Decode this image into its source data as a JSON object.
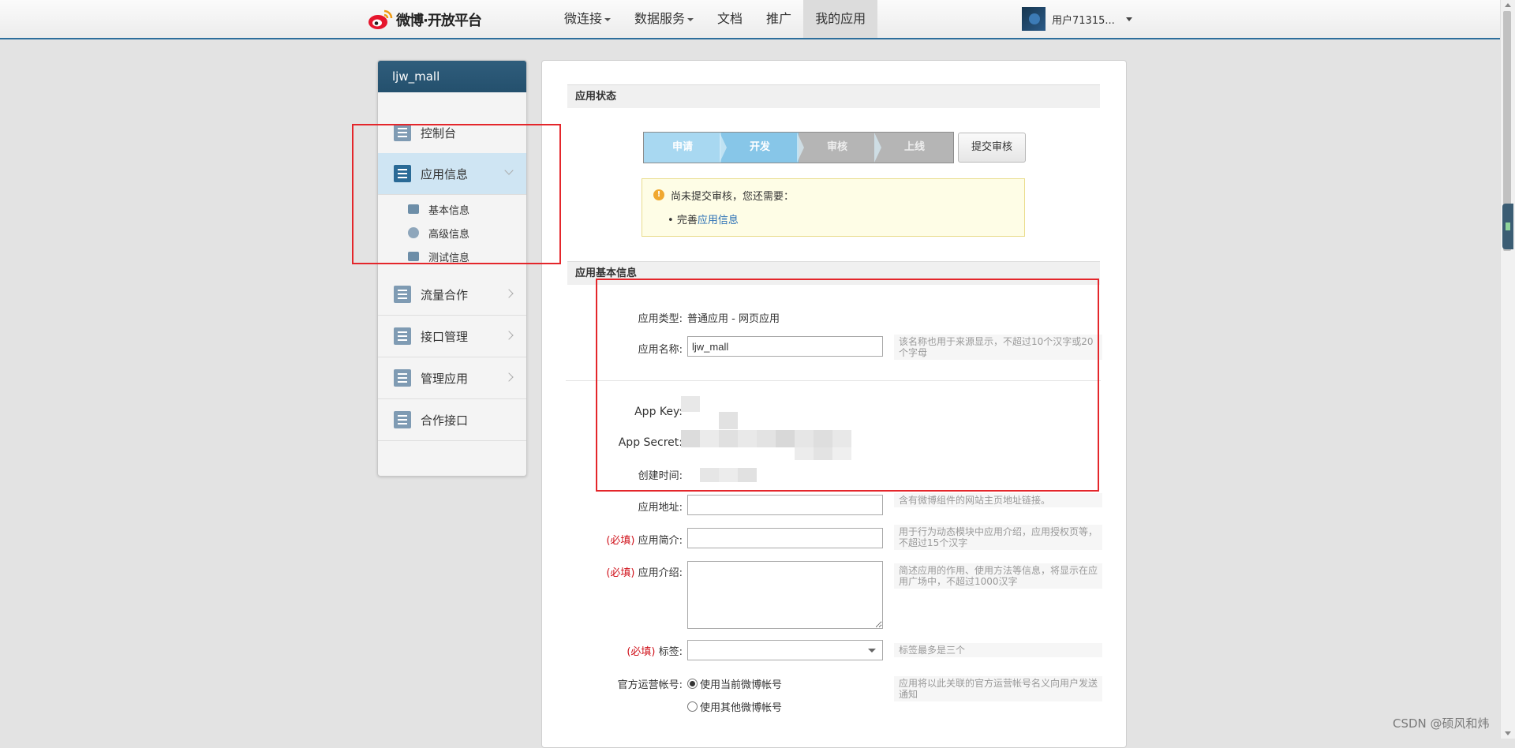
{
  "header": {
    "logo_text": "微博·开放平台",
    "nav": [
      {
        "label": "微连接",
        "dropdown": true
      },
      {
        "label": "数据服务",
        "dropdown": true
      },
      {
        "label": "文档",
        "dropdown": false
      },
      {
        "label": "推广",
        "dropdown": false
      },
      {
        "label": "我的应用",
        "dropdown": false,
        "active": true
      }
    ],
    "user_name": "用户71315..."
  },
  "sidebar": {
    "app_name": "ljw_mall",
    "items": [
      {
        "label": "控制台",
        "icon": "dashboard-icon"
      },
      {
        "label": "应用信息",
        "icon": "gear-icon",
        "active": true
      },
      {
        "label": "流量合作",
        "icon": "chart-icon"
      },
      {
        "label": "接口管理",
        "icon": "plug-icon"
      },
      {
        "label": "管理应用",
        "icon": "layers-icon"
      },
      {
        "label": "合作接口",
        "icon": "sliders-icon"
      }
    ],
    "subitems": [
      {
        "label": "基本信息",
        "icon": "id-card-icon"
      },
      {
        "label": "高级信息",
        "icon": "info-circle-icon"
      },
      {
        "label": "测试信息",
        "icon": "test-card-icon"
      }
    ]
  },
  "status": {
    "section_title": "应用状态",
    "steps": [
      "申请",
      "开发",
      "审核",
      "上线"
    ],
    "submit_label": "提交审核",
    "notice_title": "尚未提交审核，您还需要：",
    "notice_prefix": "完善",
    "notice_link": "应用信息"
  },
  "basic": {
    "section_title": "应用基本信息",
    "type_label": "应用类型:",
    "type_value": "普通应用 - 网页应用",
    "name_label": "应用名称:",
    "name_value": "ljw_mall",
    "name_hint": "该名称也用于来源显示，不超过10个汉字或20个字母",
    "appkey_label": "App Key:",
    "secret_label": "App Secret:",
    "created_label": "创建时间:",
    "url_label": "应用地址:",
    "url_hint": "含有微博组件的网站主页地址链接。",
    "required_mark": "(必填)",
    "brief_label": "应用简介:",
    "brief_hint": "用于行为动态模块中应用介绍，应用授权页等，不超过15个汉字",
    "intro_label": "应用介绍:",
    "intro_hint": "简述应用的作用、使用方法等信息，将显示在应用广场中，不超过1000汉字",
    "tags_label": "标签:",
    "tags_hint": "标签最多是三个",
    "official_label": "官方运营帐号:",
    "official_opt1": "使用当前微博帐号",
    "official_opt2": "使用其他微博帐号",
    "official_hint": "应用将以此关联的官方运营帐号名义向用户发送通知"
  },
  "watermark": "CSDN @硕风和炜",
  "colors": {
    "accent": "#2d6e9c",
    "highlight": "#e4262b",
    "required": "#d0121b"
  }
}
